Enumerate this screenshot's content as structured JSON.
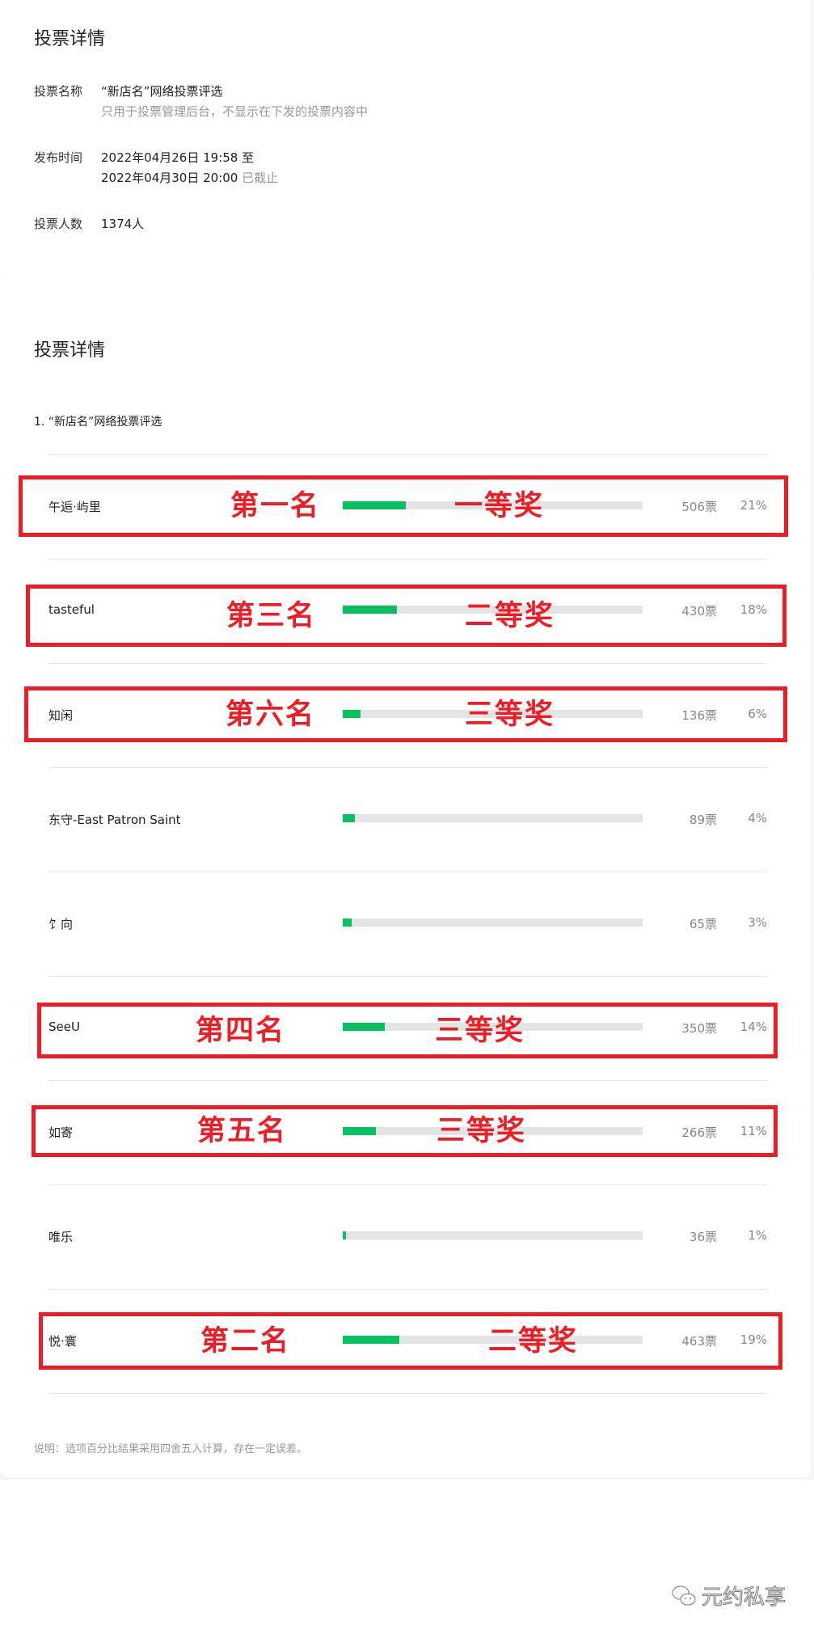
{
  "card1": {
    "title": "投票详情",
    "name_label": "投票名称",
    "name_value": "“新店名”网络投票评选",
    "name_note": "只用于投票管理后台，不显示在下发的投票内容中",
    "time_label": "发布时间",
    "time_start": "2022年04月26日 19:58 至",
    "time_end": "2022年04月30日 20:00",
    "time_status": "已截止",
    "count_label": "投票人数",
    "count_value": "1374人"
  },
  "card2": {
    "title": "投票详情",
    "question": "1. “新店名”网络投票评选",
    "options": [
      {
        "name": "午逅·屿里",
        "votes": "506票",
        "percent": "21%",
        "fill": 21
      },
      {
        "name": "tasteful",
        "votes": "430票",
        "percent": "18%",
        "fill": 18
      },
      {
        "name": "知闲",
        "votes": "136票",
        "percent": "6%",
        "fill": 6
      },
      {
        "name": "东守-East Patron Saint",
        "votes": "89票",
        "percent": "4%",
        "fill": 4
      },
      {
        "name": "饣向",
        "votes": "65票",
        "percent": "3%",
        "fill": 3
      },
      {
        "name": "SeeU",
        "votes": "350票",
        "percent": "14%",
        "fill": 14
      },
      {
        "name": "如寄",
        "votes": "266票",
        "percent": "11%",
        "fill": 11
      },
      {
        "name": "唯乐",
        "votes": "36票",
        "percent": "1%",
        "fill": 1
      },
      {
        "name": "悦·寰",
        "votes": "463票",
        "percent": "19%",
        "fill": 19
      }
    ],
    "note": "说明：选项百分比结果采用四舍五入计算，存在一定误差。"
  },
  "annotations": [
    {
      "rank": "第一名",
      "prize": "一等奖"
    },
    {
      "rank": "第三名",
      "prize": "二等奖"
    },
    {
      "rank": "第六名",
      "prize": "三等奖"
    },
    {
      "rank": "第四名",
      "prize": "三等奖"
    },
    {
      "rank": "第五名",
      "prize": "三等奖"
    },
    {
      "rank": "第二名",
      "prize": "二等奖"
    }
  ],
  "watermark": "元约私享",
  "colors": {
    "accent": "#07c160",
    "annotation": "#ee1c25",
    "track": "#e3e4e5"
  }
}
